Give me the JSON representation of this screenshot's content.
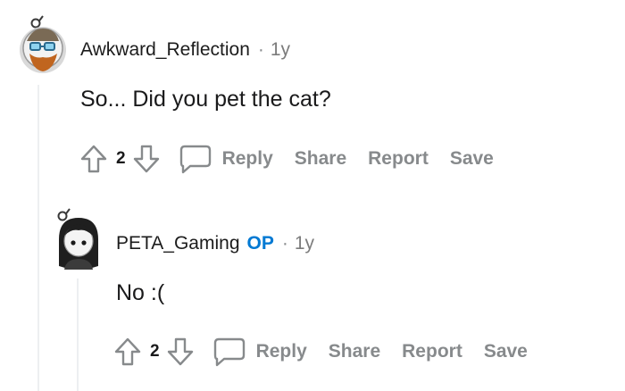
{
  "comments": [
    {
      "username": "Awkward_Reflection",
      "separator": "·",
      "age": "1y",
      "body": "So... Did you pet the cat?",
      "score": "2",
      "actions": {
        "reply": "Reply",
        "share": "Share",
        "report": "Report",
        "save": "Save"
      }
    },
    {
      "username": "PETA_Gaming",
      "badge": "OP",
      "separator": "·",
      "age": "1y",
      "body": "No :(",
      "score": "2",
      "actions": {
        "reply": "Reply",
        "share": "Share",
        "report": "Report",
        "save": "Save"
      }
    }
  ],
  "colors": {
    "op_badge": "#0079d3",
    "action_text": "#878a8c",
    "thread_line": "#edeff1"
  },
  "icons": [
    "upvote-icon",
    "downvote-icon",
    "comment-bubble-icon"
  ]
}
